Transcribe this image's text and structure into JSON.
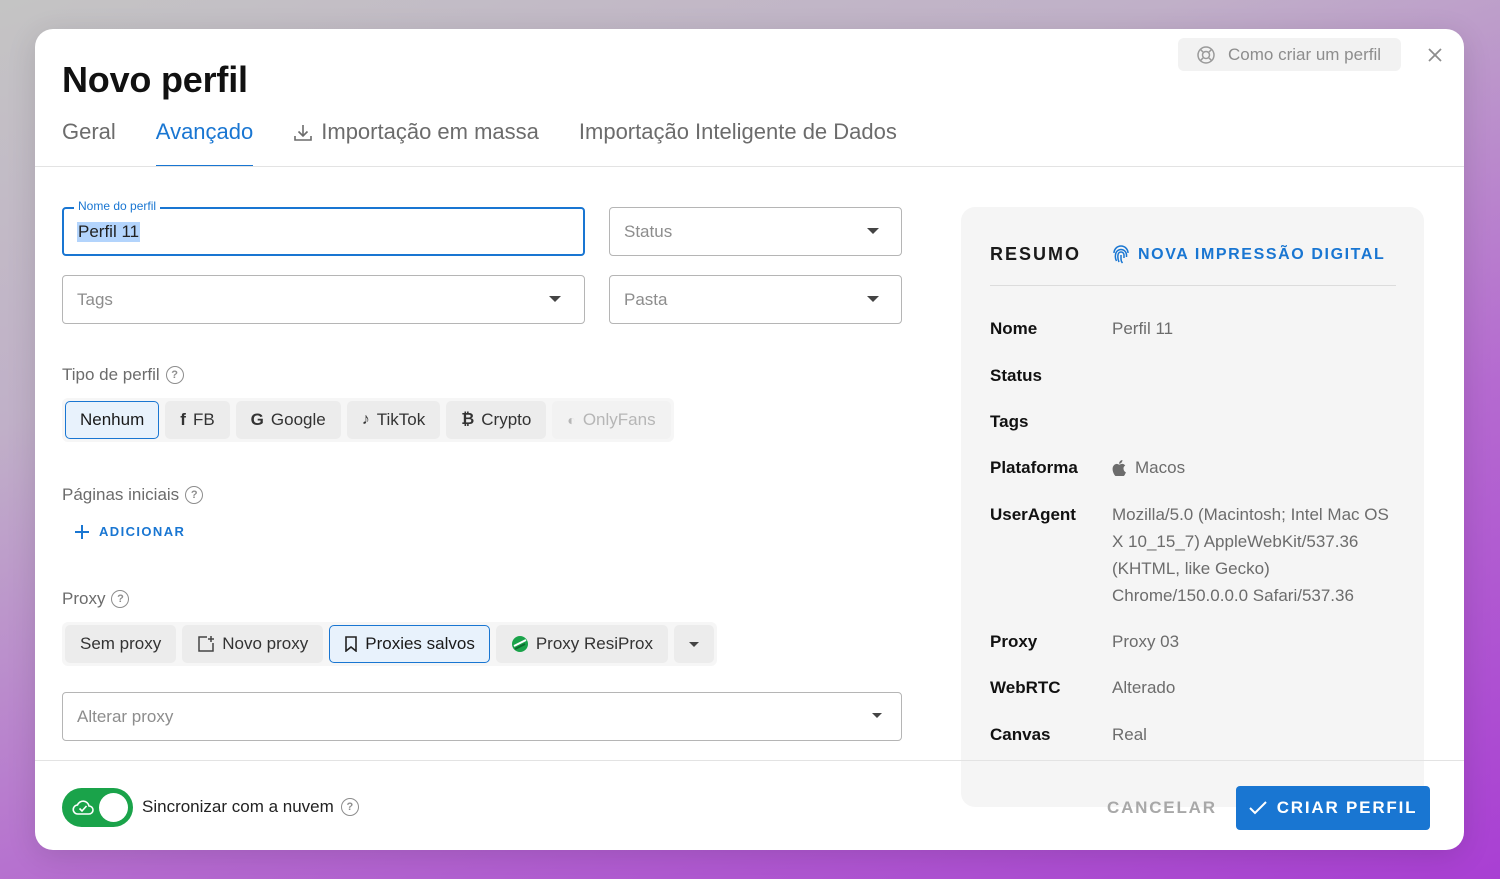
{
  "header": {
    "title": "Novo perfil",
    "help_label": "Como criar um perfil"
  },
  "tabs": [
    {
      "label": "Geral"
    },
    {
      "label": "Avançado"
    },
    {
      "label": "Importação em massa"
    },
    {
      "label": "Importação Inteligente de Dados"
    }
  ],
  "form": {
    "profile_name": {
      "label": "Nome do perfil",
      "value": "Perfil 11"
    },
    "status": {
      "placeholder": "Status"
    },
    "tags": {
      "placeholder": "Tags"
    },
    "folder": {
      "placeholder": "Pasta"
    },
    "profile_type": {
      "label": "Tipo de perfil",
      "options": [
        "Nenhum",
        "FB",
        "Google",
        "TikTok",
        "Crypto",
        "OnlyFans"
      ],
      "selected": "Nenhum"
    },
    "start_pages": {
      "label": "Páginas iniciais",
      "add_label": "ADICIONAR"
    },
    "proxy": {
      "label": "Proxy",
      "options": [
        "Sem proxy",
        "Novo proxy",
        "Proxies salvos",
        "Proxy ResiProx"
      ],
      "selected": "Proxies salvos",
      "change_placeholder": "Alterar proxy"
    }
  },
  "summary": {
    "title": "RESUMO",
    "fingerprint_link": "NOVA IMPRESSÃO DIGITAL",
    "rows": {
      "name": {
        "k": "Nome",
        "v": "Perfil 11"
      },
      "status": {
        "k": "Status",
        "v": ""
      },
      "tags": {
        "k": "Tags",
        "v": ""
      },
      "platform": {
        "k": "Plataforma",
        "v": "Macos"
      },
      "useragent": {
        "k": "UserAgent",
        "v": "Mozilla/5.0 (Macintosh; Intel Mac OS X 10_15_7) AppleWebKit/537.36 (KHTML, like Gecko) Chrome/150.0.0.0 Safari/537.36"
      },
      "proxy": {
        "k": "Proxy",
        "v": "Proxy 03"
      },
      "webrtc": {
        "k": "WebRTC",
        "v": "Alterado"
      },
      "canvas": {
        "k": "Canvas",
        "v": "Real"
      }
    }
  },
  "footer": {
    "sync_label": "Sincronizar com a nuvem",
    "sync_on": true,
    "cancel_label": "CANCELAR",
    "create_label": "CRIAR PERFIL"
  },
  "colors": {
    "accent": "#1976d2",
    "toggle_on": "#1aa34a"
  }
}
